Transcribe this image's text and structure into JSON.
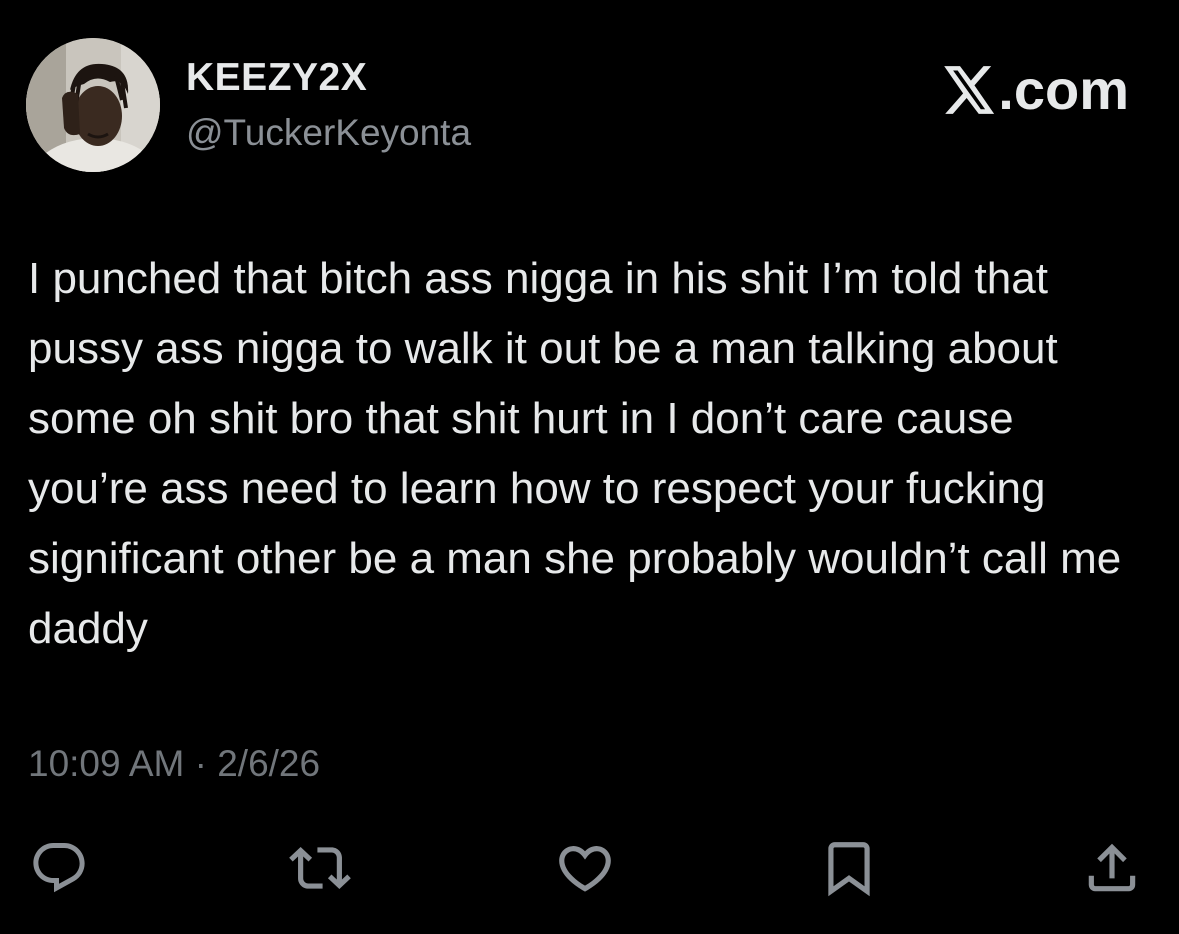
{
  "author": {
    "display_name": "KEEZY2X",
    "handle": "@TuckerKeyonta"
  },
  "brand": {
    "icon": "x-logo-icon",
    "suffix": ".com"
  },
  "tweet": {
    "text": "I punched that bitch ass nigga in his shit I’m told that pussy ass nigga to walk it out be a man talking about some oh shit bro that shit hurt in I don’t care cause you’re ass need to learn how to respect your fucking significant other be a man she probably wouldn’t call me daddy",
    "timestamp": "10:09 AM · 2/6/26"
  },
  "actions": [
    {
      "icon": "reply-icon"
    },
    {
      "icon": "retweet-icon"
    },
    {
      "icon": "like-icon"
    },
    {
      "icon": "bookmark-icon"
    },
    {
      "icon": "share-icon"
    }
  ],
  "colors": {
    "background": "#000000",
    "primary_text": "#e7e9ea",
    "secondary_text": "#71767b",
    "icon": "#8b9096"
  }
}
